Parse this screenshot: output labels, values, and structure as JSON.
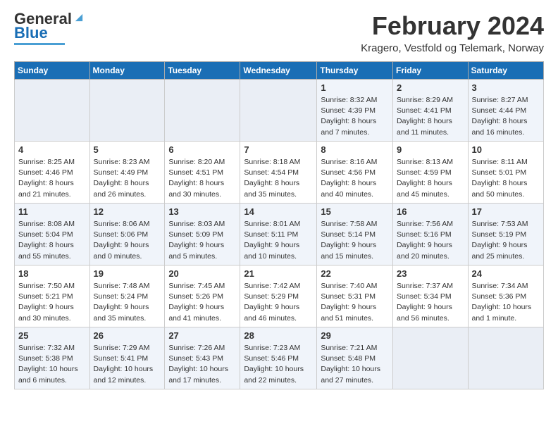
{
  "header": {
    "logo_line1": "General",
    "logo_line2": "Blue",
    "month_title": "February 2024",
    "subtitle": "Kragero, Vestfold og Telemark, Norway"
  },
  "days_of_week": [
    "Sunday",
    "Monday",
    "Tuesday",
    "Wednesday",
    "Thursday",
    "Friday",
    "Saturday"
  ],
  "weeks": [
    [
      {
        "day": "",
        "info": ""
      },
      {
        "day": "",
        "info": ""
      },
      {
        "day": "",
        "info": ""
      },
      {
        "day": "",
        "info": ""
      },
      {
        "day": "1",
        "info": "Sunrise: 8:32 AM\nSunset: 4:39 PM\nDaylight: 8 hours\nand 7 minutes."
      },
      {
        "day": "2",
        "info": "Sunrise: 8:29 AM\nSunset: 4:41 PM\nDaylight: 8 hours\nand 11 minutes."
      },
      {
        "day": "3",
        "info": "Sunrise: 8:27 AM\nSunset: 4:44 PM\nDaylight: 8 hours\nand 16 minutes."
      }
    ],
    [
      {
        "day": "4",
        "info": "Sunrise: 8:25 AM\nSunset: 4:46 PM\nDaylight: 8 hours\nand 21 minutes."
      },
      {
        "day": "5",
        "info": "Sunrise: 8:23 AM\nSunset: 4:49 PM\nDaylight: 8 hours\nand 26 minutes."
      },
      {
        "day": "6",
        "info": "Sunrise: 8:20 AM\nSunset: 4:51 PM\nDaylight: 8 hours\nand 30 minutes."
      },
      {
        "day": "7",
        "info": "Sunrise: 8:18 AM\nSunset: 4:54 PM\nDaylight: 8 hours\nand 35 minutes."
      },
      {
        "day": "8",
        "info": "Sunrise: 8:16 AM\nSunset: 4:56 PM\nDaylight: 8 hours\nand 40 minutes."
      },
      {
        "day": "9",
        "info": "Sunrise: 8:13 AM\nSunset: 4:59 PM\nDaylight: 8 hours\nand 45 minutes."
      },
      {
        "day": "10",
        "info": "Sunrise: 8:11 AM\nSunset: 5:01 PM\nDaylight: 8 hours\nand 50 minutes."
      }
    ],
    [
      {
        "day": "11",
        "info": "Sunrise: 8:08 AM\nSunset: 5:04 PM\nDaylight: 8 hours\nand 55 minutes."
      },
      {
        "day": "12",
        "info": "Sunrise: 8:06 AM\nSunset: 5:06 PM\nDaylight: 9 hours\nand 0 minutes."
      },
      {
        "day": "13",
        "info": "Sunrise: 8:03 AM\nSunset: 5:09 PM\nDaylight: 9 hours\nand 5 minutes."
      },
      {
        "day": "14",
        "info": "Sunrise: 8:01 AM\nSunset: 5:11 PM\nDaylight: 9 hours\nand 10 minutes."
      },
      {
        "day": "15",
        "info": "Sunrise: 7:58 AM\nSunset: 5:14 PM\nDaylight: 9 hours\nand 15 minutes."
      },
      {
        "day": "16",
        "info": "Sunrise: 7:56 AM\nSunset: 5:16 PM\nDaylight: 9 hours\nand 20 minutes."
      },
      {
        "day": "17",
        "info": "Sunrise: 7:53 AM\nSunset: 5:19 PM\nDaylight: 9 hours\nand 25 minutes."
      }
    ],
    [
      {
        "day": "18",
        "info": "Sunrise: 7:50 AM\nSunset: 5:21 PM\nDaylight: 9 hours\nand 30 minutes."
      },
      {
        "day": "19",
        "info": "Sunrise: 7:48 AM\nSunset: 5:24 PM\nDaylight: 9 hours\nand 35 minutes."
      },
      {
        "day": "20",
        "info": "Sunrise: 7:45 AM\nSunset: 5:26 PM\nDaylight: 9 hours\nand 41 minutes."
      },
      {
        "day": "21",
        "info": "Sunrise: 7:42 AM\nSunset: 5:29 PM\nDaylight: 9 hours\nand 46 minutes."
      },
      {
        "day": "22",
        "info": "Sunrise: 7:40 AM\nSunset: 5:31 PM\nDaylight: 9 hours\nand 51 minutes."
      },
      {
        "day": "23",
        "info": "Sunrise: 7:37 AM\nSunset: 5:34 PM\nDaylight: 9 hours\nand 56 minutes."
      },
      {
        "day": "24",
        "info": "Sunrise: 7:34 AM\nSunset: 5:36 PM\nDaylight: 10 hours\nand 1 minute."
      }
    ],
    [
      {
        "day": "25",
        "info": "Sunrise: 7:32 AM\nSunset: 5:38 PM\nDaylight: 10 hours\nand 6 minutes."
      },
      {
        "day": "26",
        "info": "Sunrise: 7:29 AM\nSunset: 5:41 PM\nDaylight: 10 hours\nand 12 minutes."
      },
      {
        "day": "27",
        "info": "Sunrise: 7:26 AM\nSunset: 5:43 PM\nDaylight: 10 hours\nand 17 minutes."
      },
      {
        "day": "28",
        "info": "Sunrise: 7:23 AM\nSunset: 5:46 PM\nDaylight: 10 hours\nand 22 minutes."
      },
      {
        "day": "29",
        "info": "Sunrise: 7:21 AM\nSunset: 5:48 PM\nDaylight: 10 hours\nand 27 minutes."
      },
      {
        "day": "",
        "info": ""
      },
      {
        "day": "",
        "info": ""
      }
    ]
  ]
}
